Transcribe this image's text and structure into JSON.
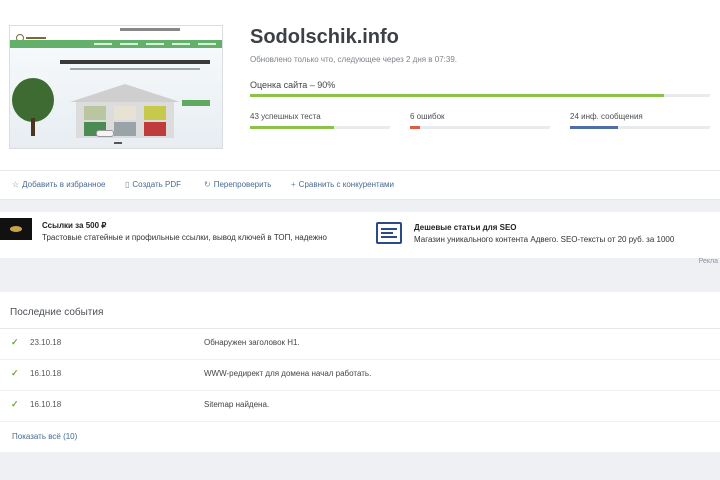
{
  "site": {
    "name": "Sodolschik.info",
    "updated": "Обновлено только что, следующее через 2 дня в 07:39.",
    "score_label": "Оценка сайта – 90%",
    "score_percent": 90
  },
  "stats": [
    {
      "label": "43 успешных теста",
      "fill": 0.6,
      "color": "#8bc34a"
    },
    {
      "label": "6 ошибок",
      "fill": 0.07,
      "color": "#e05a4a"
    },
    {
      "label": "24 инф. сообщения",
      "fill": 0.34,
      "color": "#4c6fa8"
    }
  ],
  "actions": {
    "favorite": "Добавить в избранное",
    "pdf": "Создать PDF",
    "recheck": "Перепроверить",
    "compare": "Сравнить с конкурентами"
  },
  "ads": {
    "ad1_title": "Ссылки за 500 ₽",
    "ad1_text": "Трастовые статейные и профильные ссылки, вывод ключей в ТОП, надежно",
    "ad2_title": "Дешевые статьи для SEO",
    "ad2_text": "Магазин уникального контента Адвего. SEO-тексты от 20 руб. за 1000",
    "ad_link": "Рекла"
  },
  "events": {
    "title": "Последние события",
    "items": [
      {
        "date": "23.10.18",
        "text": "Обнаружен заголовок H1."
      },
      {
        "date": "16.10.18",
        "text": "WWW-редирект для домена начал работать."
      },
      {
        "date": "16.10.18",
        "text": "Sitemap найдена."
      }
    ],
    "show_all": "Показать всё (10)"
  },
  "colors": {
    "accent_link": "#4a6a94",
    "success": "#8bc34a",
    "error": "#e05a4a",
    "info": "#4c6fa8"
  },
  "icons": {
    "favorite": "star-icon",
    "pdf": "document-icon",
    "recheck": "refresh-icon",
    "compare": "plus-icon",
    "event": "check-icon"
  }
}
